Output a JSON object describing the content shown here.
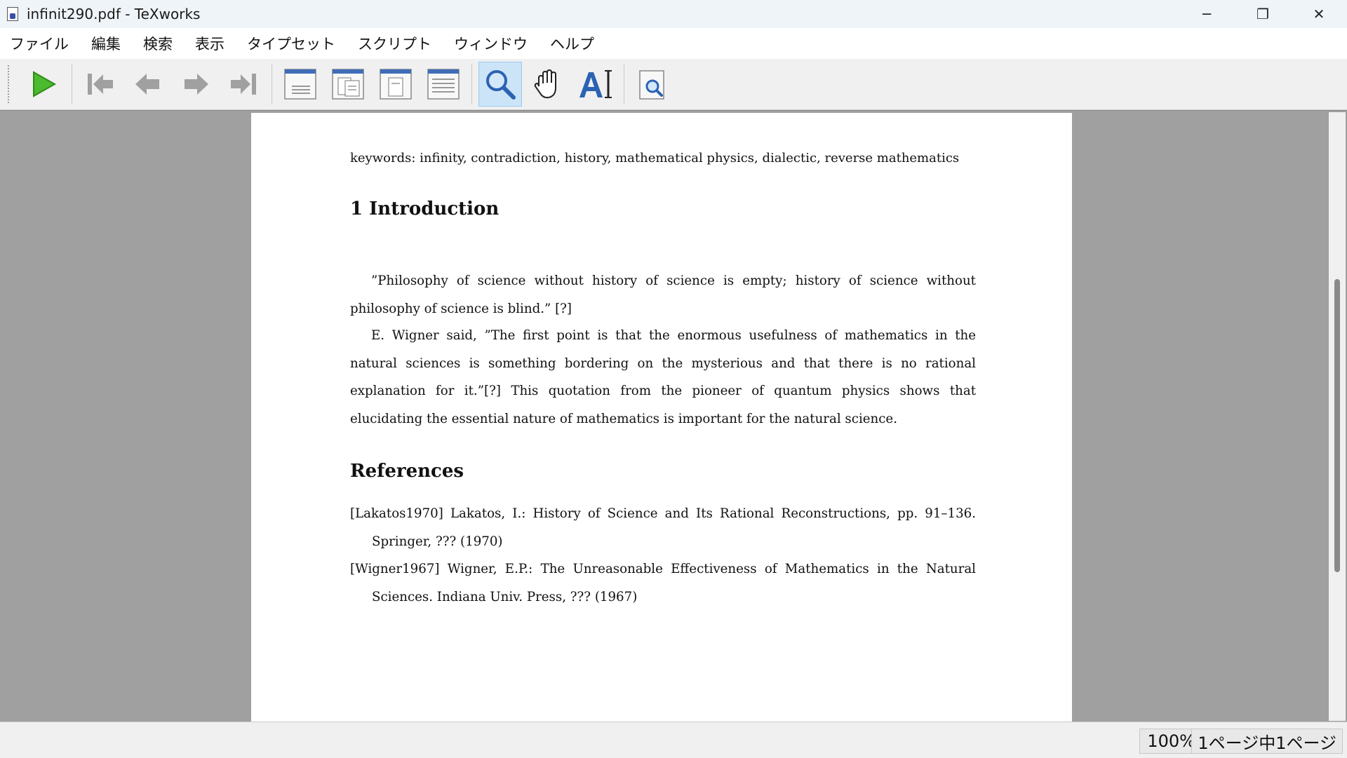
{
  "window": {
    "title": "infinit290.pdf - TeXworks",
    "controls": {
      "minimize": "─",
      "restore": "❐",
      "close": "✕"
    }
  },
  "menu": [
    "ファイル",
    "編集",
    "検索",
    "表示",
    "タイプセット",
    "スクリプト",
    "ウィンドウ",
    "ヘルプ"
  ],
  "toolbar": {
    "typeset": "play-icon",
    "nav": [
      "first-page-icon",
      "previous-page-icon",
      "next-page-icon",
      "last-page-icon"
    ],
    "layout": [
      "single-page-icon",
      "facing-pages-icon",
      "fit-page-icon",
      "continuous-icon"
    ],
    "tools": [
      "magnifier-icon",
      "hand-icon",
      "text-select-icon"
    ],
    "find": "find-in-pdf-icon",
    "active_tool": "magnifier-icon",
    "colors": {
      "play": "#4cba2f",
      "arrows": "#909090",
      "accent_blue": "#2b63b3"
    }
  },
  "document": {
    "keywords": "keywords: infinity, contradiction, history, mathematical physics, dialectic, reverse mathematics",
    "section": "1  Introduction",
    "paragraphs": [
      "”Philosophy of science without history of science is empty; history of science without philosophy of science is blind.” [?]",
      "E. Wigner said, ”The first point is that the enormous usefulness of mathematics in the natural sciences is something bordering on the mysterious and that there is no rational explanation for it.”[?] This quotation from the pioneer of quantum physics shows that elucidating the essential nature of mathematics is important for the natural science."
    ],
    "references_heading": "References",
    "references": [
      "[Lakatos1970]  Lakatos, I.: History of Science and Its Rational Reconstructions, pp. 91–136. Springer, ??? (1970)",
      "[Wigner1967]  Wigner, E.P.: The Unreasonable Effectiveness of Mathematics in the Natural Sciences. Indiana Univ. Press, ??? (1967)"
    ]
  },
  "status": {
    "zoom": "100%",
    "page": "1ページ中1ページ"
  }
}
